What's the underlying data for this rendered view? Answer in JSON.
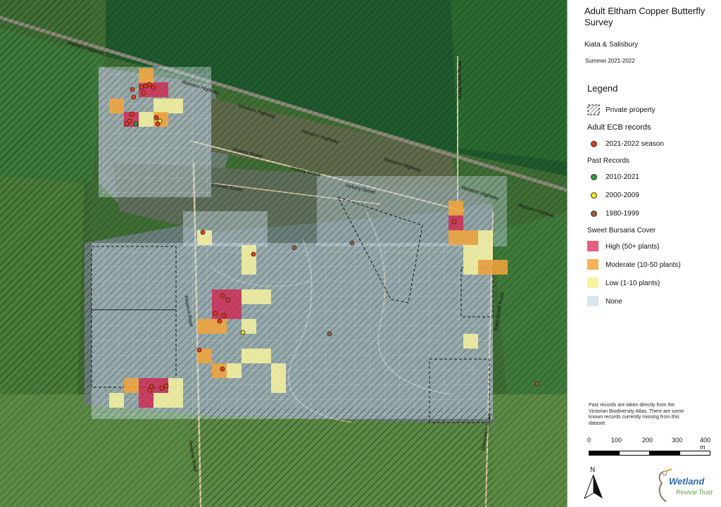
{
  "title": "Adult Eltham Copper Butterfly Survey",
  "subtitle": "Kiata & Salisbury",
  "season": "Summer 2021-2022",
  "legend": {
    "title": "Legend",
    "private_property": "Private property",
    "adult_records_heading": "Adult ECB records",
    "current_season": "2021-2022 season",
    "past_records_heading": "Past Records",
    "past_1": "2010-2021",
    "past_2": "2000-2009",
    "past_3": "1980-1999",
    "cover_heading": "Sweet Bursaria Cover",
    "cover_high": "High (50+ plants)",
    "cover_moderate": "Moderate (10-50 plants)",
    "cover_low": "Low (1-10 plants)",
    "cover_none": "None"
  },
  "colors": {
    "record_2021": "#e83a1c",
    "record_2010": "#2e9e3a",
    "record_2000": "#f2e61a",
    "record_1980": "#9b5a3a",
    "cover_high": "#d61e4a",
    "cover_moderate": "#f5a53a",
    "cover_low": "#f7f3a0",
    "cover_none": "#d6e6ee"
  },
  "note": "Past records are taken directly from the Victorian Biodiversity Atlas. There are some known records currently missing from this dataset.",
  "scale": {
    "ticks": [
      "0",
      "100",
      "200",
      "300",
      "400 m"
    ]
  },
  "north_label": "N",
  "logo": {
    "line1": "Wetland",
    "line2": "Revival Trust"
  },
  "roads": {
    "western_highway": "Western Highway",
    "kiata_north": "Kiata North Road",
    "vickery": "Vickery Street",
    "emmett": "Emmett Street",
    "reserve": "Reserve Road",
    "kiata_south": "Kiata South Road",
    "recreation": "Recreation Road"
  }
}
